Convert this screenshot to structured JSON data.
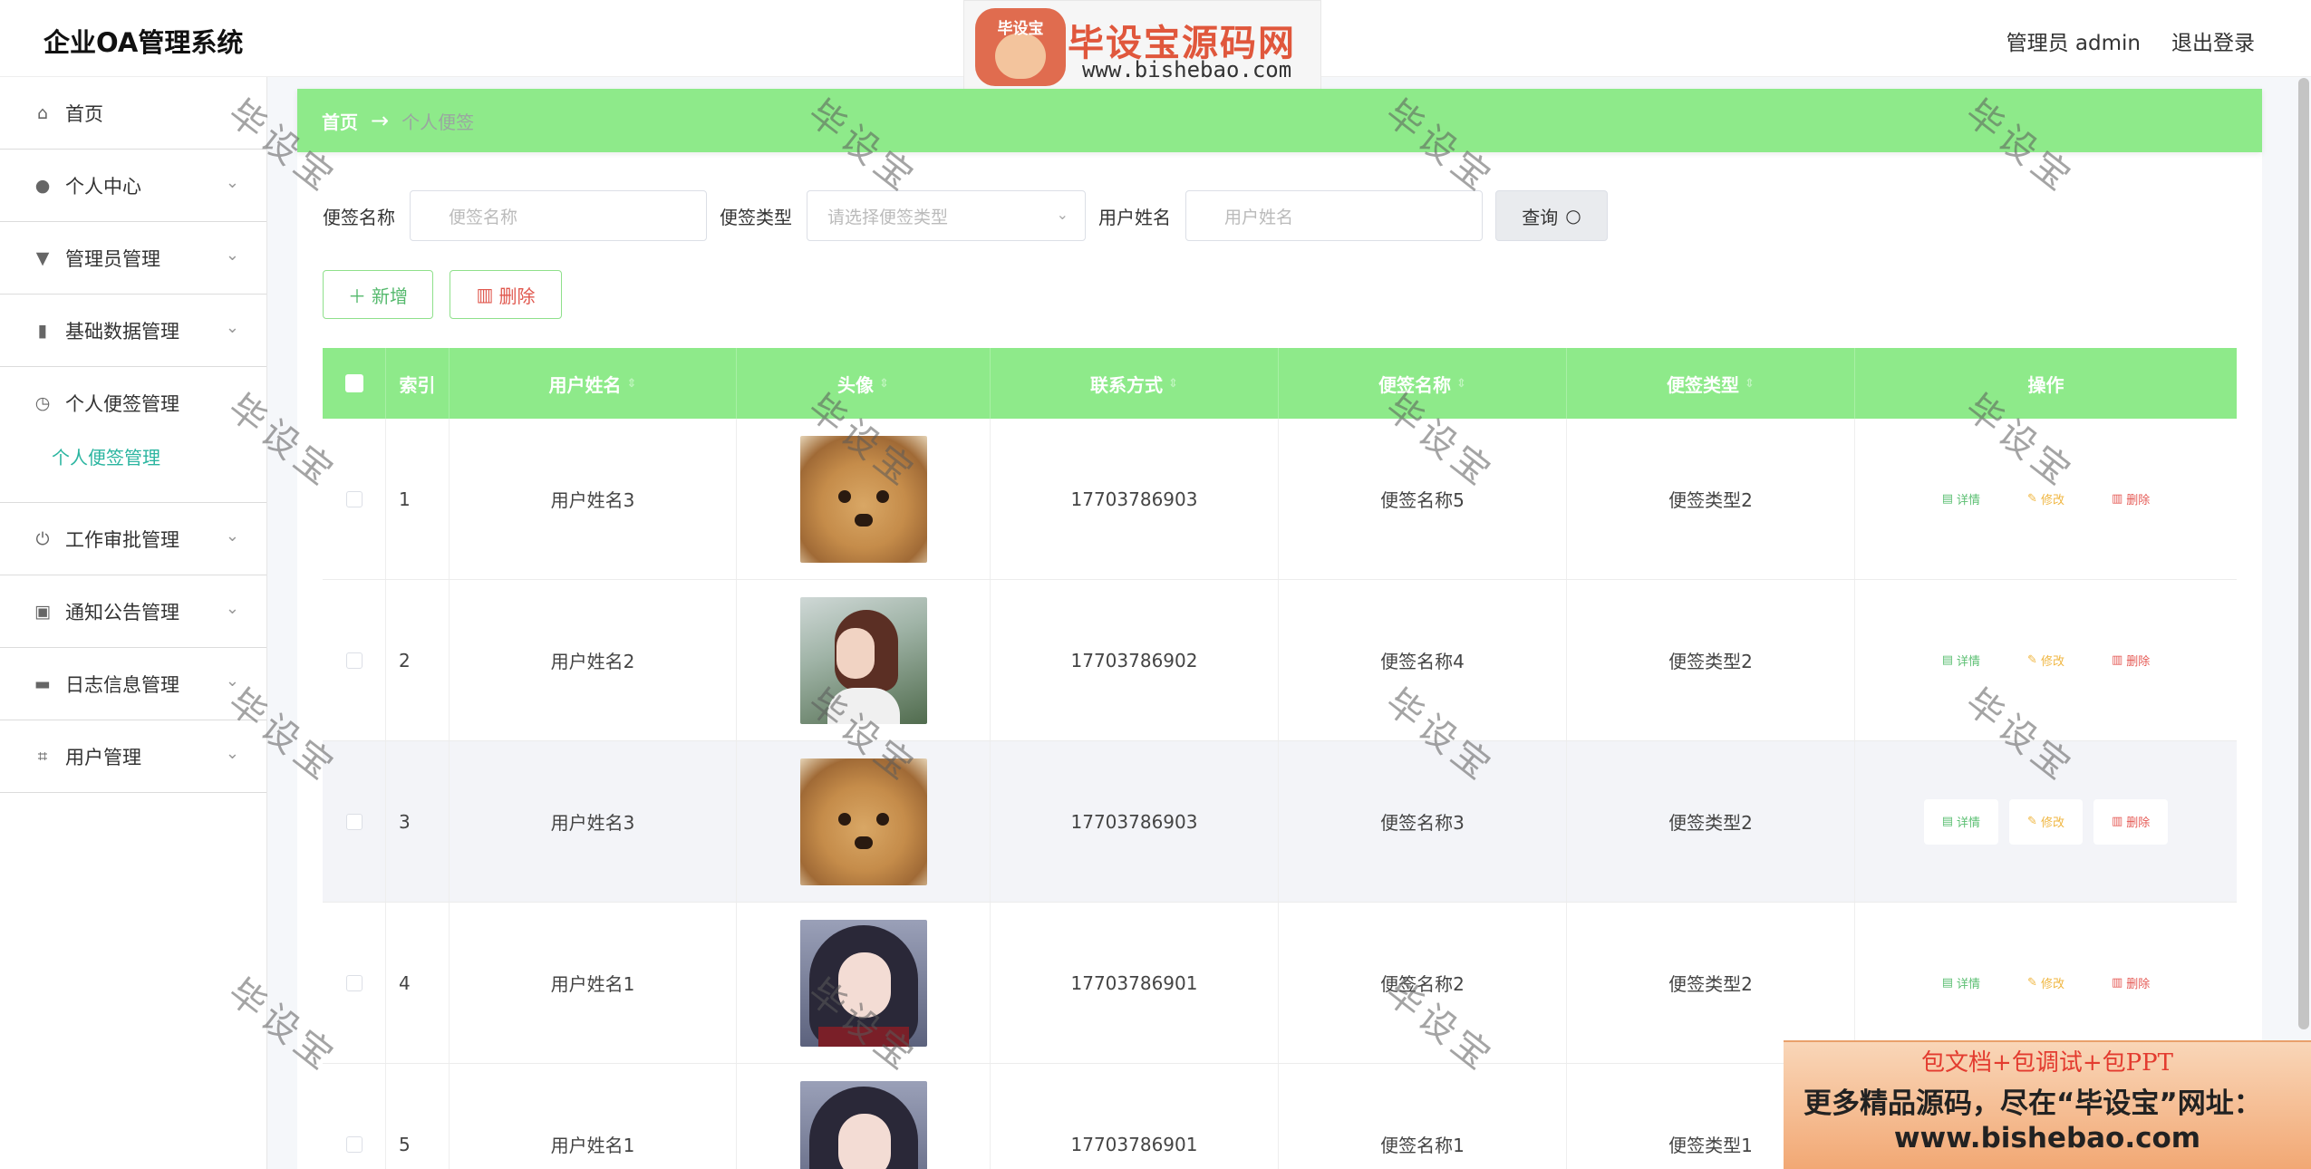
{
  "header": {
    "app_title": "企业OA管理系统",
    "admin_label": "管理员 admin",
    "logout": "退出登录"
  },
  "watermark_logo": {
    "badge_text": "毕设宝",
    "site_name": "毕设宝源码网",
    "url": "www.bishebao.com"
  },
  "sidebar": {
    "items": [
      {
        "label": "首页",
        "icon": "home-icon",
        "glyph": "⌂"
      },
      {
        "label": "个人中心",
        "icon": "user-icon",
        "glyph": "●"
      },
      {
        "label": "管理员管理",
        "icon": "stamp-icon",
        "glyph": "▼"
      },
      {
        "label": "基础数据管理",
        "icon": "bar-chart-icon",
        "glyph": "▮"
      },
      {
        "label": "个人便签管理",
        "icon": "clock-icon",
        "glyph": "◷"
      },
      {
        "label": "工作审批管理",
        "icon": "power-icon",
        "glyph": "⏻"
      },
      {
        "label": "通知公告管理",
        "icon": "clipboard-icon",
        "glyph": "▣"
      },
      {
        "label": "日志信息管理",
        "icon": "chat-icon",
        "glyph": "▬"
      },
      {
        "label": "用户管理",
        "icon": "crop-icon",
        "glyph": "⌗"
      }
    ],
    "subitem": "个人便签管理"
  },
  "breadcrumb": {
    "home": "首页",
    "arrow": "→",
    "current": "个人便签"
  },
  "search": {
    "name_label": "便签名称",
    "name_placeholder": "便签名称",
    "type_label": "便签类型",
    "type_placeholder": "请选择便签类型",
    "user_label": "用户姓名",
    "user_placeholder": "用户姓名",
    "query_button": "查询"
  },
  "actions": {
    "add": "新增",
    "delete": "删除"
  },
  "table": {
    "headers": [
      "索引",
      "用户姓名",
      "头像",
      "联系方式",
      "便签名称",
      "便签类型",
      "操作"
    ],
    "row_actions": {
      "detail": "详情",
      "edit": "修改",
      "remove": "删除"
    },
    "rows": [
      {
        "index": "1",
        "user": "用户姓名3",
        "avatar": "puppy",
        "phone": "17703786903",
        "note_name": "便签名称5",
        "note_type": "便签类型2"
      },
      {
        "index": "2",
        "user": "用户姓名2",
        "avatar": "girl-profile",
        "phone": "17703786902",
        "note_name": "便签名称4",
        "note_type": "便签类型2"
      },
      {
        "index": "3",
        "user": "用户姓名3",
        "avatar": "puppy",
        "phone": "17703786903",
        "note_name": "便签名称3",
        "note_type": "便签类型2"
      },
      {
        "index": "4",
        "user": "用户姓名1",
        "avatar": "girl-portrait",
        "phone": "17703786901",
        "note_name": "便签名称2",
        "note_type": "便签类型2"
      },
      {
        "index": "5",
        "user": "用户姓名1",
        "avatar": "girl-portrait",
        "phone": "17703786901",
        "note_name": "便签名称1",
        "note_type": "便签类型1"
      }
    ]
  },
  "overlay": {
    "watermark_text": "毕设宝",
    "promo_line1": "包文档+包调试+包PPT",
    "promo_line2": "更多精品源码，尽在“毕设宝”网址：",
    "promo_line3": "www.bishebao.com"
  },
  "colors": {
    "accent_green": "#8eea8a",
    "submenu_teal": "#2bb5a0",
    "danger": "#e0574d"
  }
}
